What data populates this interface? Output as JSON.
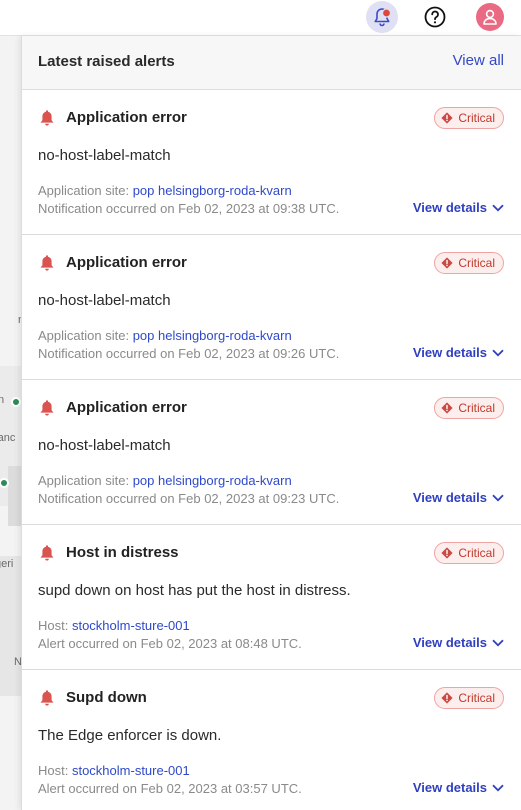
{
  "topbar": {
    "icons": [
      "bell-icon",
      "help-icon",
      "user-icon"
    ],
    "colors": {
      "bell_bg": "#dfe0f3",
      "bell_dot": "#e0453a",
      "avatar": "#ea6a84"
    }
  },
  "map": {
    "labels": [
      "n",
      "ranc",
      "geri",
      "N"
    ]
  },
  "panel": {
    "title": "Latest raised alerts",
    "view_all_label": "View all",
    "colors": {
      "link": "#3548c4",
      "critical": "#c0392b",
      "bell": "#d9534f"
    },
    "alerts": [
      {
        "title": "Application error",
        "severity": "Critical",
        "description": "no-host-label-match",
        "meta_label": "Application site:",
        "meta_value": "pop helsingborg-roda-kvarn",
        "occurred": "Notification occurred on Feb 02, 2023 at 09:38 UTC.",
        "details_label": "View details"
      },
      {
        "title": "Application error",
        "severity": "Critical",
        "description": "no-host-label-match",
        "meta_label": "Application site:",
        "meta_value": "pop helsingborg-roda-kvarn",
        "occurred": "Notification occurred on Feb 02, 2023 at 09:26 UTC.",
        "details_label": "View details"
      },
      {
        "title": "Application error",
        "severity": "Critical",
        "description": "no-host-label-match",
        "meta_label": "Application site:",
        "meta_value": "pop helsingborg-roda-kvarn",
        "occurred": "Notification occurred on Feb 02, 2023 at 09:23 UTC.",
        "details_label": "View details"
      },
      {
        "title": "Host in distress",
        "severity": "Critical",
        "description": "supd down on host has put the host in distress.",
        "meta_label": "Host:",
        "meta_value": "stockholm-sture-001",
        "occurred": "Alert occurred on Feb 02, 2023 at 08:48 UTC.",
        "details_label": "View details"
      },
      {
        "title": "Supd down",
        "severity": "Critical",
        "description": "The Edge enforcer is down.",
        "meta_label": "Host:",
        "meta_value": "stockholm-sture-001",
        "occurred": "Alert occurred on Feb 02, 2023 at 03:57 UTC.",
        "details_label": "View details"
      }
    ]
  }
}
